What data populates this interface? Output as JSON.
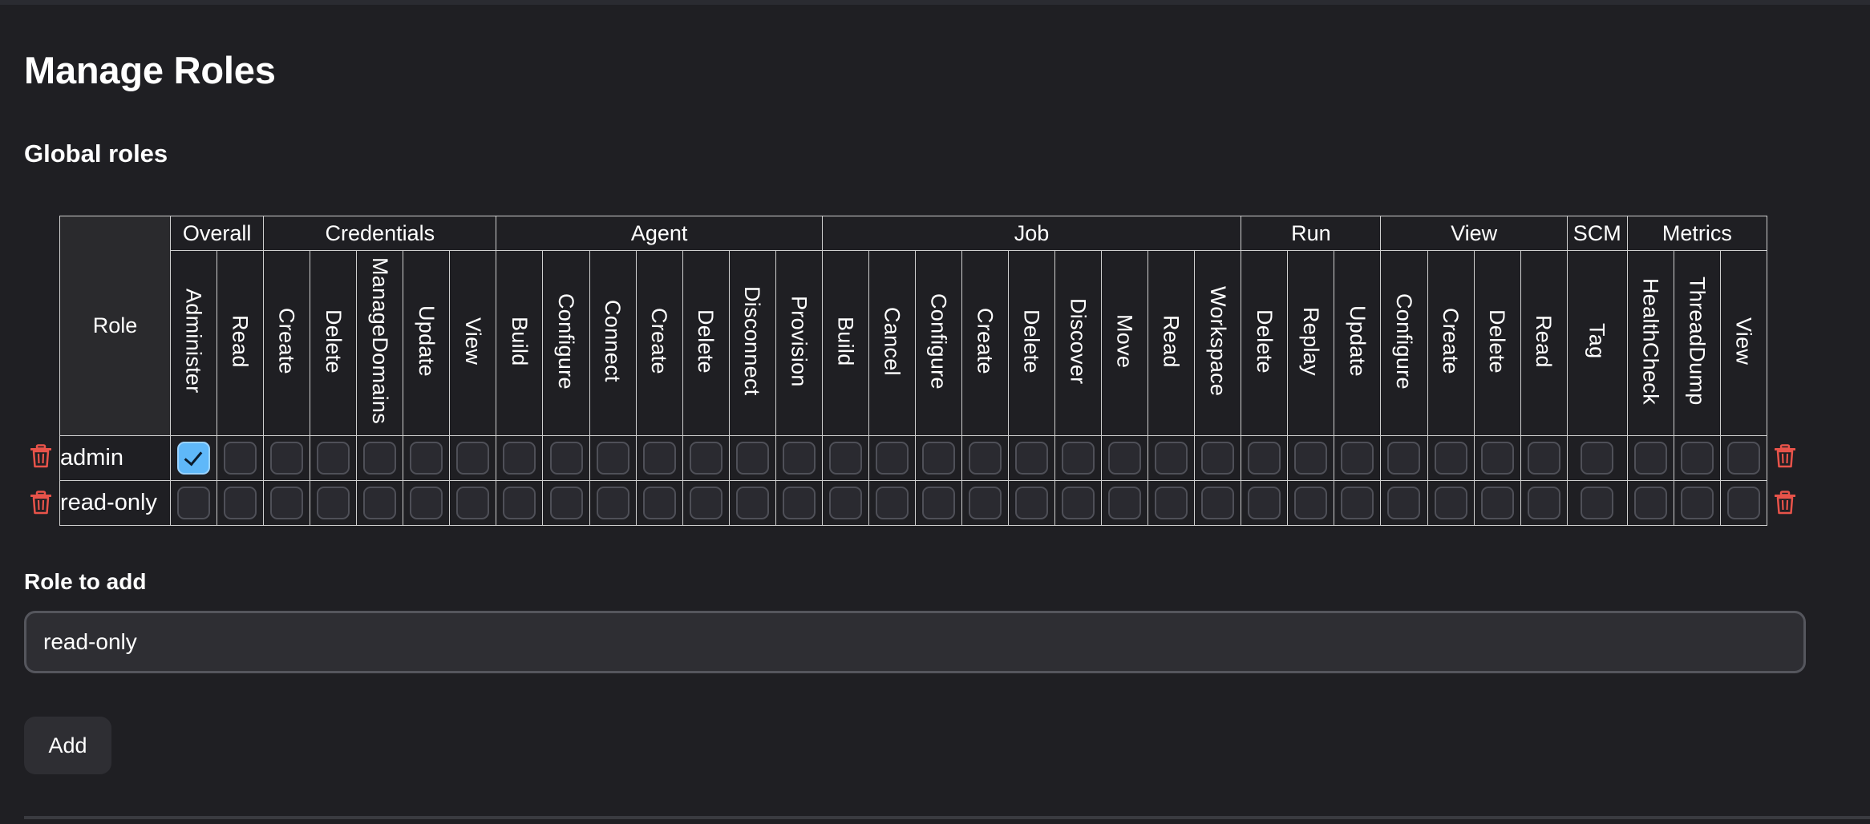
{
  "page": {
    "title": "Manage Roles",
    "section_title": "Global roles"
  },
  "table": {
    "role_header": "Role",
    "categories": [
      {
        "name": "Overall",
        "permissions": [
          "Administer",
          "Read"
        ]
      },
      {
        "name": "Credentials",
        "permissions": [
          "Create",
          "Delete",
          "ManageDomains",
          "Update",
          "View"
        ]
      },
      {
        "name": "Agent",
        "permissions": [
          "Build",
          "Configure",
          "Connect",
          "Create",
          "Delete",
          "Disconnect",
          "Provision"
        ]
      },
      {
        "name": "Job",
        "permissions": [
          "Build",
          "Cancel",
          "Configure",
          "Create",
          "Delete",
          "Discover",
          "Move",
          "Read",
          "Workspace"
        ]
      },
      {
        "name": "Run",
        "permissions": [
          "Delete",
          "Replay",
          "Update"
        ]
      },
      {
        "name": "View",
        "permissions": [
          "Configure",
          "Create",
          "Delete",
          "Read"
        ]
      },
      {
        "name": "SCM",
        "permissions": [
          "Tag"
        ]
      },
      {
        "name": "Metrics",
        "permissions": [
          "HealthCheck",
          "ThreadDump",
          "View"
        ]
      }
    ],
    "roles": [
      {
        "name": "admin",
        "checked": [
          "Overall/Administer"
        ]
      },
      {
        "name": "read-only",
        "checked": []
      }
    ]
  },
  "icons": {
    "delete_role": "trash-icon",
    "checked_mark": "checkmark-icon"
  },
  "colors": {
    "background": "#1f1f23",
    "checkbox_checked": "#5fb8f9",
    "delete_icon": "#e8534a"
  },
  "form": {
    "label": "Role to add",
    "input_value": "read-only",
    "button_label": "Add"
  }
}
